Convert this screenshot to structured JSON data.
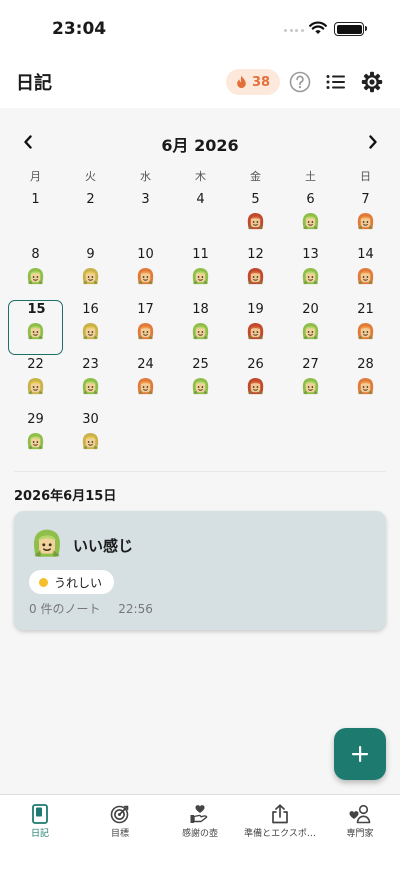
{
  "status_bar": {
    "time": "23:04"
  },
  "header": {
    "title": "日記",
    "streak_count": "38",
    "icons": [
      "flame-icon",
      "help-icon",
      "list-icon",
      "settings-icon"
    ]
  },
  "calendar": {
    "month_label": "6月 2026",
    "weekdays": [
      "月",
      "火",
      "水",
      "木",
      "金",
      "土",
      "日"
    ],
    "leading_blank_cells": 0,
    "selected_day": 15,
    "days": [
      {
        "n": "1",
        "mood": ""
      },
      {
        "n": "2",
        "mood": ""
      },
      {
        "n": "3",
        "mood": ""
      },
      {
        "n": "4",
        "mood": ""
      },
      {
        "n": "5",
        "mood": "red"
      },
      {
        "n": "6",
        "mood": "green"
      },
      {
        "n": "7",
        "mood": "orange"
      },
      {
        "n": "8",
        "mood": "green"
      },
      {
        "n": "9",
        "mood": "yellow"
      },
      {
        "n": "10",
        "mood": "orange"
      },
      {
        "n": "11",
        "mood": "green"
      },
      {
        "n": "12",
        "mood": "red"
      },
      {
        "n": "13",
        "mood": "green"
      },
      {
        "n": "14",
        "mood": "orange"
      },
      {
        "n": "15",
        "mood": "green"
      },
      {
        "n": "16",
        "mood": "yellow"
      },
      {
        "n": "17",
        "mood": "orange"
      },
      {
        "n": "18",
        "mood": "green"
      },
      {
        "n": "19",
        "mood": "red"
      },
      {
        "n": "20",
        "mood": "green"
      },
      {
        "n": "21",
        "mood": "orange"
      },
      {
        "n": "22",
        "mood": "yellow"
      },
      {
        "n": "23",
        "mood": "green"
      },
      {
        "n": "24",
        "mood": "orange"
      },
      {
        "n": "25",
        "mood": "green"
      },
      {
        "n": "26",
        "mood": "red"
      },
      {
        "n": "27",
        "mood": "green"
      },
      {
        "n": "28",
        "mood": "orange"
      },
      {
        "n": "29",
        "mood": "green"
      },
      {
        "n": "30",
        "mood": "yellow"
      }
    ],
    "mood_colors": {
      "green": {
        "hood": "#8fbf4a",
        "face": "#f2d29b",
        "hair": "#b6d86a"
      },
      "yellow": {
        "hood": "#c9b24a",
        "face": "#f1d09a",
        "hair": "#e5c84c"
      },
      "orange": {
        "hood": "#e07b3c",
        "face": "#f2cc96",
        "hair": "#f29a4a"
      },
      "red": {
        "hood": "#c0492f",
        "face": "#f0c793",
        "hair": "#d8653b"
      }
    }
  },
  "selected_date": {
    "label": "2026年6月15日",
    "entry": {
      "mood_label": "いい感じ",
      "tag_label": "うれしい",
      "note_count_label": "0 件のノート",
      "time": "22:56"
    }
  },
  "fab": {
    "icon": "plus-icon"
  },
  "bottom_nav": {
    "active": 0,
    "items": [
      {
        "label": "日記",
        "icon": "diary-icon"
      },
      {
        "label": "目標",
        "icon": "target-icon"
      },
      {
        "label": "感謝の壺",
        "icon": "gratitude-jar-icon"
      },
      {
        "label": "準備とエクスポ…",
        "icon": "share-icon"
      },
      {
        "label": "専門家",
        "icon": "expert-icon"
      }
    ]
  },
  "colors": {
    "accent": "#1d7a6f",
    "selected_border": "#1f6f67",
    "streak_bg": "#fde9dc",
    "streak_text": "#e2703a",
    "card_bg": "#d6e0e3",
    "tag_dot": "#f5bf2c"
  }
}
